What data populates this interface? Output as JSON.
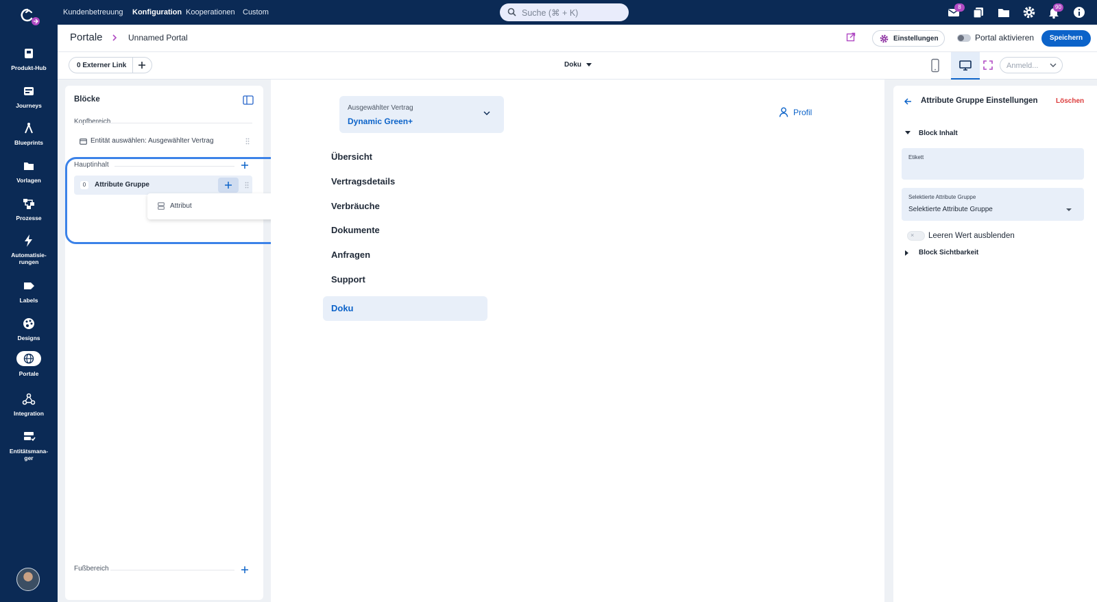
{
  "topbar": {
    "nav": [
      "Kundenbetreuung",
      "Konfiguration",
      "Kooperationen",
      "Custom"
    ],
    "active_nav": "Konfiguration",
    "search_placeholder": "Suche (⌘ + K)",
    "icons": [
      "mail-icon",
      "copy-icon",
      "folder-icon",
      "gear-icon",
      "bell-icon",
      "info-icon"
    ],
    "mail_badge": "8",
    "bell_badge": "90"
  },
  "sidebar": {
    "items": [
      {
        "label": "Produkt-Hub",
        "icon": "box-icon"
      },
      {
        "label": "Journeys",
        "icon": "journey-icon"
      },
      {
        "label": "Blueprints",
        "icon": "compass-icon"
      },
      {
        "label": "Vorlagen",
        "icon": "folder-icon"
      },
      {
        "label": "Prozesse",
        "icon": "process-icon"
      },
      {
        "label": "Automatisie-\nrungen",
        "icon": "bolt-icon"
      },
      {
        "label": "Labels",
        "icon": "label-icon"
      },
      {
        "label": "Designs",
        "icon": "palette-icon"
      },
      {
        "label": "Portale",
        "icon": "globe-icon",
        "active": true
      },
      {
        "label": "Integration",
        "icon": "webhook-icon"
      },
      {
        "label": "Entitätsmana-\nger",
        "icon": "entity-icon"
      }
    ]
  },
  "header": {
    "title": "Portale",
    "portal_name": "Unnamed Portal",
    "settings_label": "Einstellungen",
    "activate_label": "Portal aktivieren",
    "save_label": "Speichern"
  },
  "toolbar": {
    "external_link_label": "0 Externer Link",
    "page_select": "Doku",
    "login_select": "Anmeld..."
  },
  "blocks": {
    "title": "Blöcke",
    "header_section": "Kopfbereich",
    "header_item": "Entität auswählen: Ausgewählter Vertrag",
    "main_section": "Hauptinhalt",
    "main_item_count": "0",
    "main_item": "Attribute Gruppe",
    "popup_item": "Attribut",
    "footer_section": "Fußbereich"
  },
  "canvas": {
    "contract_label": "Ausgewählter Vertrag",
    "contract_value": "Dynamic Green+",
    "profile_label": "Profil",
    "menu": [
      "Übersicht",
      "Vertragsdetails",
      "Verbräuche",
      "Dokumente",
      "Anfragen",
      "Support"
    ],
    "menu_active": "Doku"
  },
  "settings": {
    "title": "Attribute Gruppe Einstellungen",
    "delete_label": "Löschen",
    "block_content": "Block Inhalt",
    "etikett_label": "Etikett",
    "etikett_value": "",
    "group_label": "Selektierte Attribute Gruppe",
    "group_value": "Selektierte Attribute Gruppe",
    "hide_empty_label": "Leeren Wert ausblenden",
    "visibility_label": "Block Sichtbarkeit"
  },
  "colors": {
    "navy": "#0b2a55",
    "accent": "#0c63c9",
    "highlight": "#3b82e8",
    "danger": "#dc3b3b",
    "badge": "#b04ac3"
  }
}
